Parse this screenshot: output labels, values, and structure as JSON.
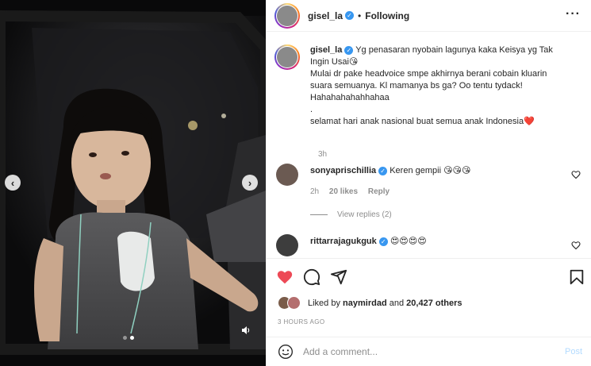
{
  "header": {
    "username": "gisel_la",
    "follow_separator": "•",
    "follow_status": "Following",
    "more_icon": "more-horizontal-icon"
  },
  "caption": {
    "username": "gisel_la",
    "line1": "Yg penasaran nyobain lagunya kaka Keisya yg Tak Ingin Usai😘",
    "line2": "Mulai dr pake headvoice smpe akhirnya berani cobain kluarin suara semuanya. Kl mamanya bs ga? Oo tentu tydack! Hahahahahahhahaa",
    "line3": ".",
    "line4": "selamat hari anak nasional buat semua anak Indonesia❤️",
    "time": "3h"
  },
  "comments": [
    {
      "username": "sonyaprischillia",
      "text": "Keren gempii 😘😘😘",
      "time": "2h",
      "likes": "20 likes",
      "reply": "Reply"
    },
    {
      "username": "rittarrajagukguk",
      "text": "😍😍😍😍"
    }
  ],
  "view_replies": "View replies (2)",
  "actions": {
    "liked": true,
    "liked_by_prefix": "Liked by",
    "liked_by_user": "naymirdad",
    "liked_by_and": "and",
    "liked_by_others": "20,427 others",
    "time_ago": "3 HOURS AGO"
  },
  "add_comment": {
    "placeholder": "Add a comment...",
    "post_label": "Post"
  },
  "media": {
    "carousel_dots": 2,
    "active_dot": 1
  },
  "colors": {
    "like_red": "#ed4956",
    "verified_blue": "#3897f0",
    "post_disabled": "#b3dbff",
    "secondary_text": "#8e8e8e"
  }
}
